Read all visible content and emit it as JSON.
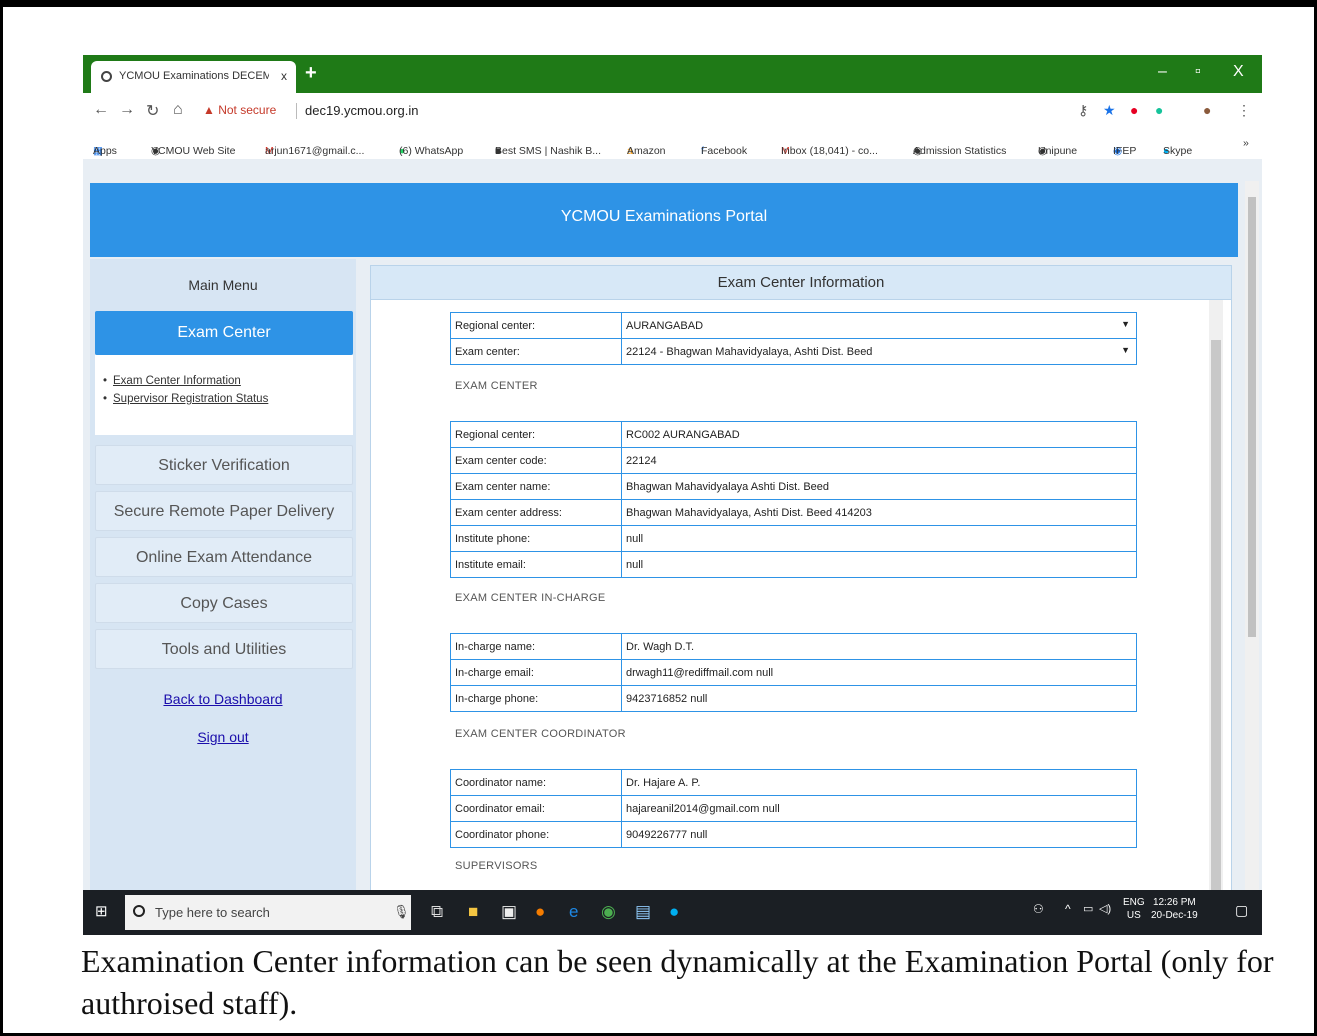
{
  "browser": {
    "tab_title": "YCMOU Examinations DECEMBE",
    "tab_close": "x",
    "new_tab": "+",
    "window_controls": [
      "–",
      "▫",
      "X"
    ],
    "not_secure": "Not secure",
    "url": "dec19.ycmou.org.in",
    "bookmarks": [
      "Apps",
      "YCMOU Web Site",
      "arjun1671@gmail.c...",
      "(6) WhatsApp",
      "Best SMS | Nashik B...",
      "Amazon",
      "Facebook",
      "Inbox (18,041) - co...",
      "Admission Statistics",
      "Unipune",
      "IFEP",
      "Skype",
      "»"
    ]
  },
  "header": {
    "title": "YCMOU Examinations Portal"
  },
  "sidebar": {
    "title": "Main Menu",
    "active": "Exam Center",
    "sub_items": [
      "Exam Center Information",
      "Supervisor Registration Status"
    ],
    "buttons": [
      "Sticker Verification",
      "Secure Remote Paper Delivery",
      "Online Exam Attendance",
      "Copy Cases",
      "Tools and Utilities"
    ],
    "links": [
      "Back to Dashboard",
      "Sign out"
    ]
  },
  "content": {
    "heading": "Exam Center Information",
    "selectors": [
      {
        "label": "Regional center:",
        "value": "AURANGABAD"
      },
      {
        "label": "Exam center:",
        "value": "22124 - Bhagwan Mahavidyalaya, Ashti Dist. Beed"
      }
    ],
    "sections": [
      {
        "title": "EXAM CENTER",
        "rows": [
          {
            "label": "Regional center:",
            "value": "RC002 AURANGABAD"
          },
          {
            "label": "Exam center code:",
            "value": "22124"
          },
          {
            "label": "Exam center name:",
            "value": "Bhagwan Mahavidyalaya Ashti Dist. Beed"
          },
          {
            "label": "Exam center address:",
            "value": "Bhagwan Mahavidyalaya, Ashti Dist. Beed 414203"
          },
          {
            "label": "Institute phone:",
            "value": "null"
          },
          {
            "label": "Institute email:",
            "value": "null"
          }
        ]
      },
      {
        "title": "EXAM CENTER IN-CHARGE",
        "rows": [
          {
            "label": "In-charge name:",
            "value": "Dr. Wagh D.T."
          },
          {
            "label": "In-charge email:",
            "value": "drwagh11@rediffmail.com null"
          },
          {
            "label": "In-charge phone:",
            "value": "9423716852 null"
          }
        ]
      },
      {
        "title": "EXAM CENTER COORDINATOR",
        "rows": [
          {
            "label": "Coordinator name:",
            "value": "Dr. Hajare A. P."
          },
          {
            "label": "Coordinator email:",
            "value": "hajareanil2014@gmail.com null"
          },
          {
            "label": "Coordinator phone:",
            "value": "9049226777 null"
          }
        ]
      },
      {
        "title": "SUPERVISORS",
        "rows": []
      }
    ]
  },
  "taskbar": {
    "search_placeholder": "Type here to search",
    "lang_top": "ENG",
    "lang_bottom": "US",
    "time": "12:26 PM",
    "date": "20-Dec-19"
  },
  "caption": "Examination Center information can be seen dynamically at the Examination Portal (only for authroised staff)."
}
